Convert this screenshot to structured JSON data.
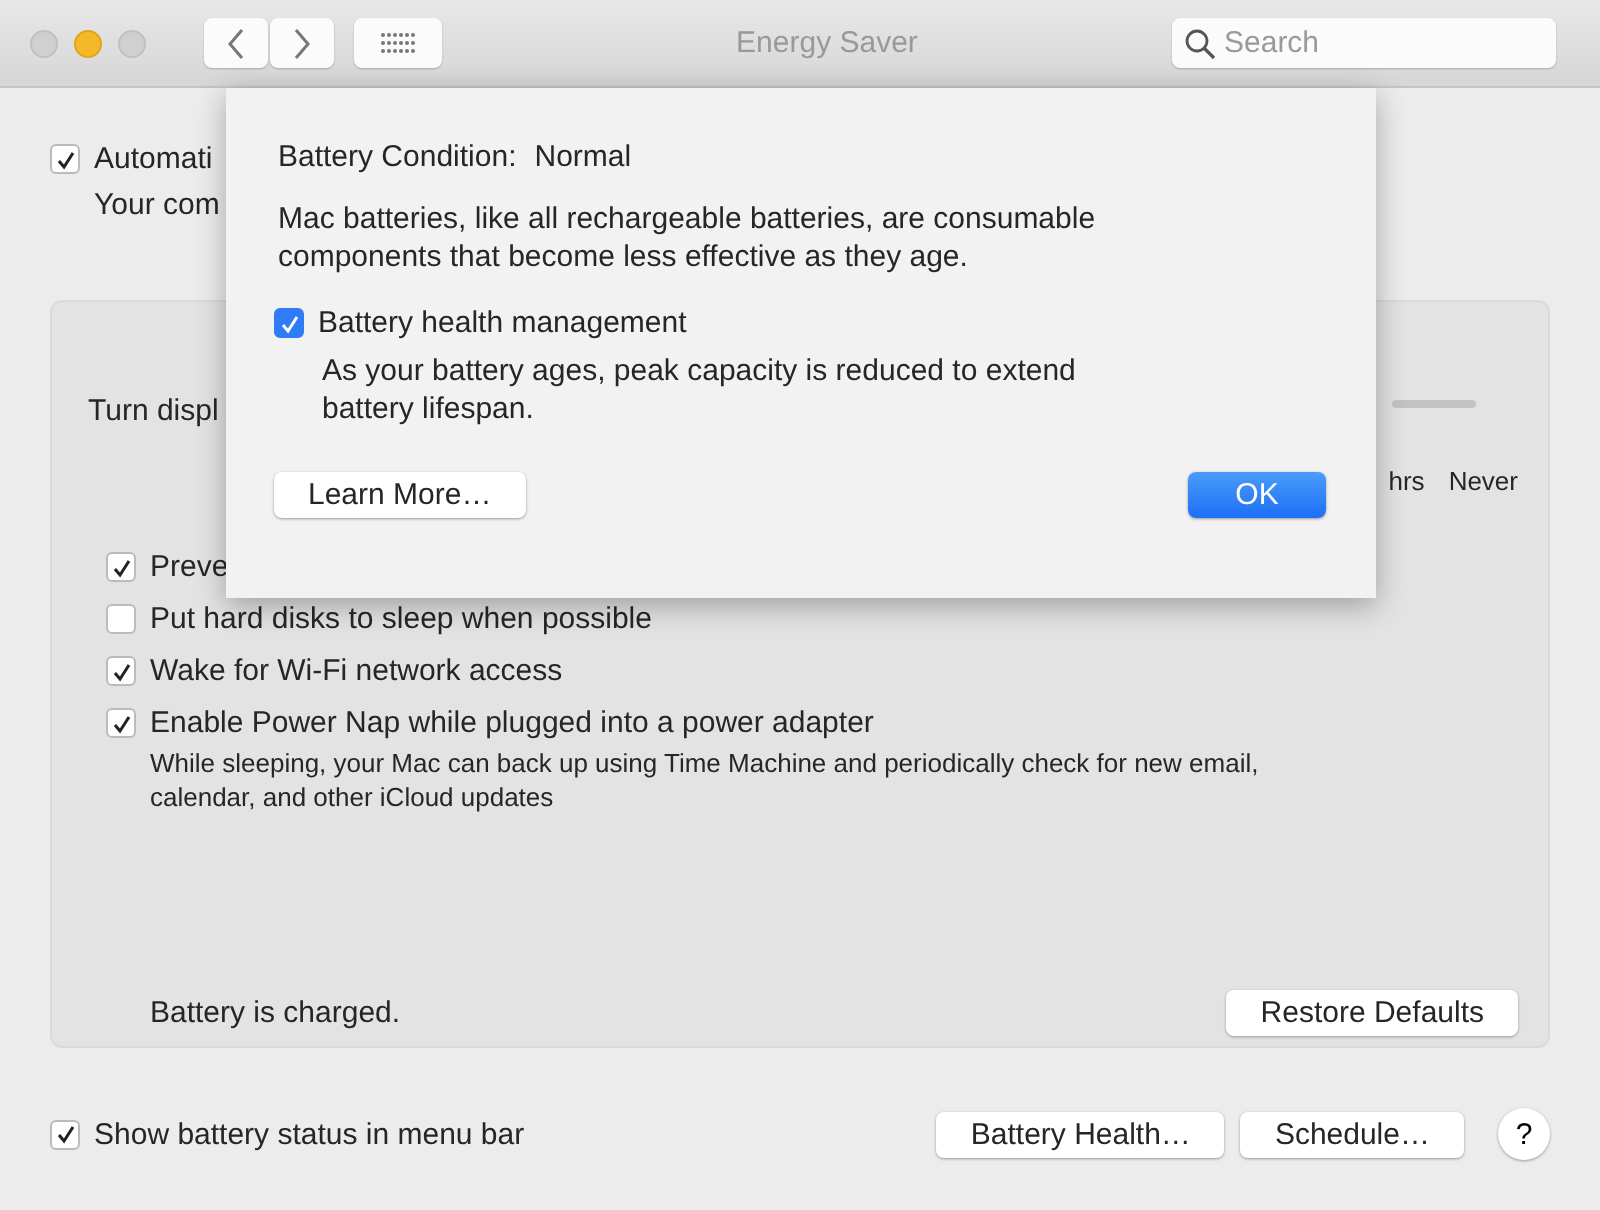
{
  "window": {
    "title": "Energy Saver"
  },
  "search": {
    "placeholder": "Search"
  },
  "top_option": {
    "label": "Automati",
    "checked": true
  },
  "top_note": "Your com",
  "panel": {
    "slider_label": "Turn displ",
    "slider_ticks": [
      "hrs",
      "Never"
    ],
    "options": [
      {
        "label": "Preve",
        "checked": true
      },
      {
        "label": "Put hard disks to sleep when possible",
        "checked": false
      },
      {
        "label": "Wake for Wi-Fi network access",
        "checked": true
      },
      {
        "label": "Enable Power Nap while plugged into a power adapter",
        "checked": true,
        "description": "While sleeping, your Mac can back up using Time Machine and periodically check for new email, calendar, and other iCloud updates"
      }
    ],
    "status": "Battery is charged.",
    "restore_button": "Restore Defaults"
  },
  "bottom": {
    "option": {
      "label": "Show battery status in menu bar",
      "checked": true
    },
    "buttons": [
      "Battery Health…",
      "Schedule…"
    ],
    "help": "?"
  },
  "sheet": {
    "condition_label": "Battery Condition:",
    "condition_value": "Normal",
    "description": "Mac batteries, like all rechargeable batteries, are consumable components that become less effective as they age.",
    "option": {
      "label": "Battery health management",
      "checked": true,
      "description": "As your battery ages, peak capacity is reduced to extend battery lifespan."
    },
    "buttons": [
      {
        "label": "Learn More…",
        "kind": "normal"
      },
      {
        "label": "OK",
        "kind": "default"
      }
    ]
  }
}
